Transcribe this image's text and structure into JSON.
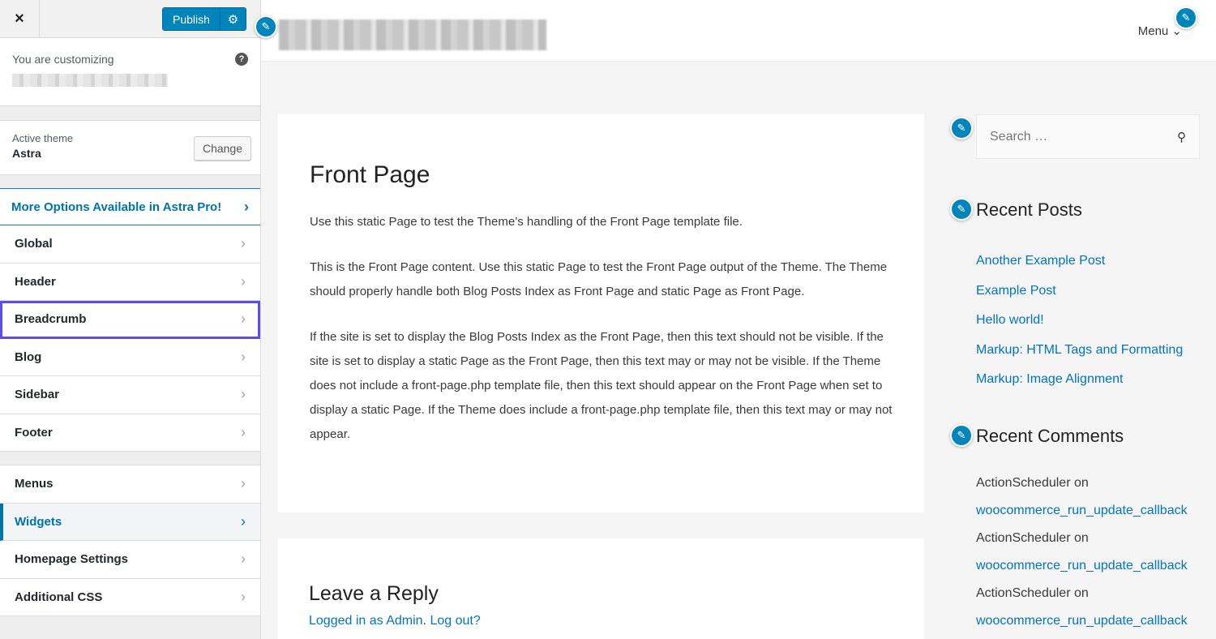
{
  "customizer": {
    "close_icon": "×",
    "publish_label": "Publish",
    "gear_icon": "⚙",
    "customizing_label": "You are customizing",
    "help_icon": "?",
    "active_theme_label": "Active theme",
    "active_theme_name": "Astra",
    "change_label": "Change",
    "pro_label": "More Options Available in Astra Pro!",
    "chevron": "›",
    "sections_group1": [
      {
        "label": "Global"
      },
      {
        "label": "Header"
      },
      {
        "label": "Breadcrumb"
      },
      {
        "label": "Blog"
      },
      {
        "label": "Sidebar"
      },
      {
        "label": "Footer"
      }
    ],
    "sections_group2": [
      {
        "label": "Menus"
      },
      {
        "label": "Widgets"
      },
      {
        "label": "Homepage Settings"
      },
      {
        "label": "Additional CSS"
      }
    ]
  },
  "preview": {
    "pen_icon": "✎",
    "menu_label": "Menu ⌄",
    "page_title": "Front Page",
    "paragraphs": [
      "Use this static Page to test the Theme’s handling of the Front Page template file.",
      "This is the Front Page content. Use this static Page to test the Front Page output of the Theme. The Theme should properly handle both Blog Posts Index as Front Page and static Page as Front Page.",
      "If the site is set to display the Blog Posts Index as the Front Page, then this text should not be visible. If the site is set to display a static Page as the Front Page, then this text may or may not be visible. If the Theme does not include a front-page.php template file, then this text should appear on the Front Page when set to display a static Page. If the Theme does include a front-page.php template file, then this text may or may not appear."
    ],
    "reply_title": "Leave a Reply",
    "logged_in_text": "Logged in as Admin",
    "logout_text": "Log out?",
    "search_placeholder": "Search …",
    "search_icon": "🔍",
    "recent_posts_title": "Recent Posts",
    "recent_posts": [
      "Another Example Post",
      "Example Post",
      "Hello world!",
      "Markup: HTML Tags and Formatting",
      "Markup: Image Alignment"
    ],
    "recent_comments_title": "Recent Comments",
    "recent_comments": [
      {
        "author": "ActionScheduler on",
        "post": "woocommerce_run_update_callback"
      },
      {
        "author": "ActionScheduler on",
        "post": "woocommerce_run_update_callback"
      },
      {
        "author": "ActionScheduler on",
        "post": "woocommerce_run_update_callback"
      }
    ]
  }
}
